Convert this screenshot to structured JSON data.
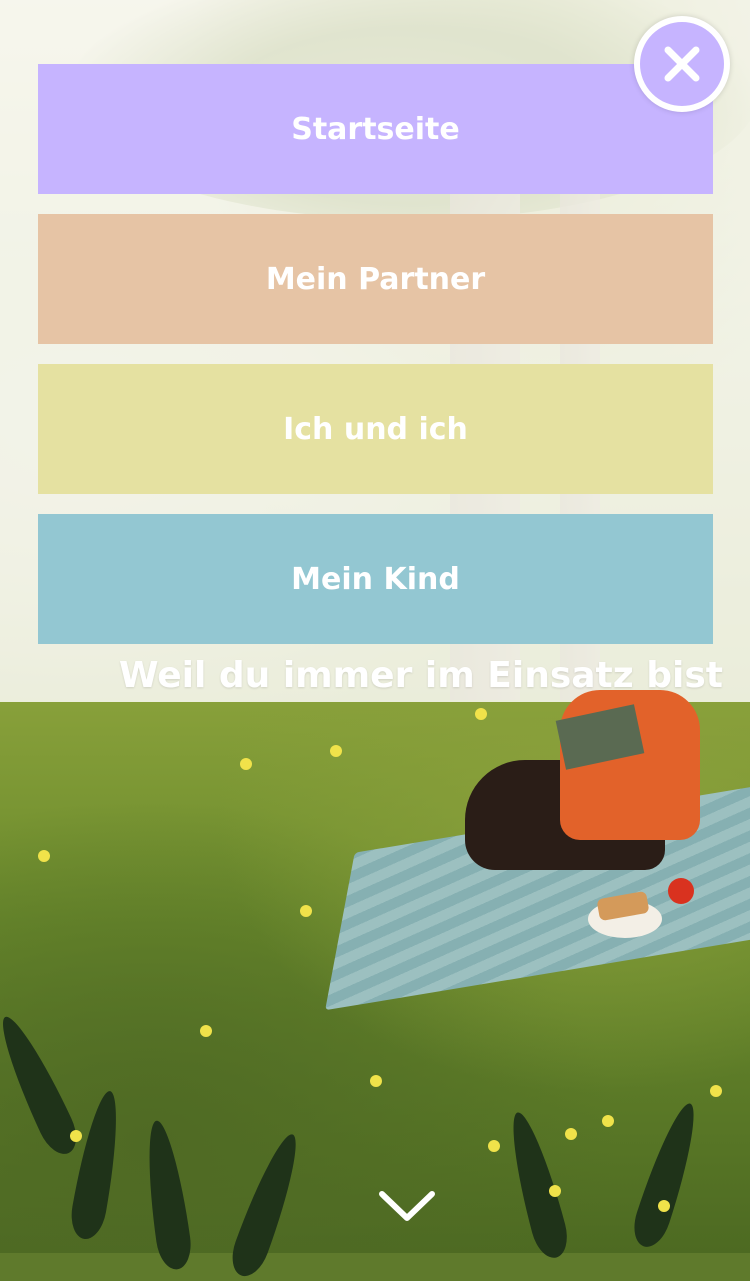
{
  "menu": {
    "items": [
      {
        "label": "Startseite",
        "color": "#c6b4ff"
      },
      {
        "label": "Mein Partner",
        "color": "#e6c4a5"
      },
      {
        "label": "Ich und ich",
        "color": "#e5e1a1"
      },
      {
        "label": "Mein Kind",
        "color": "#93c7d2"
      }
    ],
    "close_icon": "close-icon"
  },
  "hero": {
    "tagline": "Weil du immer im Einsatz bist",
    "scroll_icon": "chevron-down-icon"
  }
}
